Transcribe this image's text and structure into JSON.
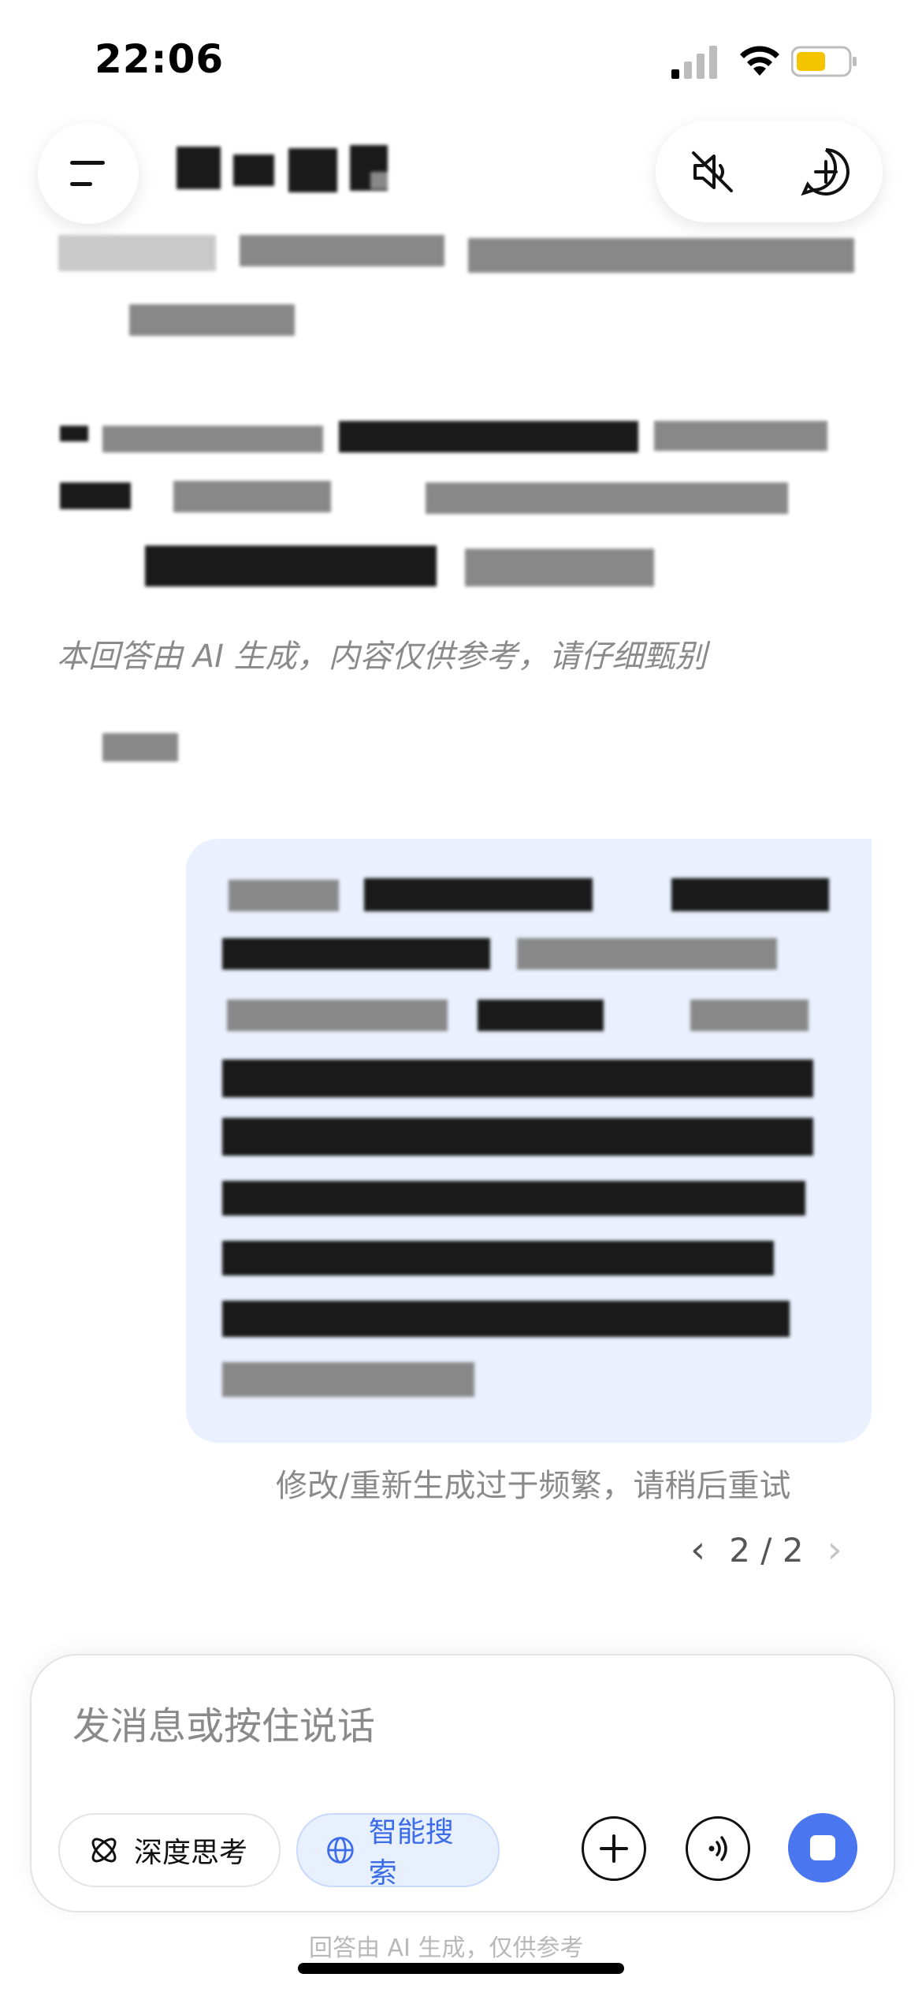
{
  "status_bar": {
    "time": "22:06"
  },
  "header": {
    "menu_icon": "menu-icon",
    "mute_icon": "speaker-off-icon",
    "new_chat_icon": "new-chat-icon"
  },
  "assistant": {
    "disclaimer": "本回答由 AI 生成，内容仅供参考，请仔细甄别"
  },
  "user_message": {
    "notice": "修改/重新生成过于频繁，请稍后重试",
    "pager": {
      "current": "2",
      "separator": "/",
      "total": "2"
    }
  },
  "composer": {
    "placeholder": "发消息或按住说话",
    "deep_think_label": "深度思考",
    "smart_search_label": "智能搜索",
    "add_icon": "plus-icon",
    "voice_icon": "voice-call-icon",
    "stop_icon": "stop-icon"
  },
  "footer_note": "回答由 AI 生成，仅供参考",
  "colors": {
    "accent": "#4a76f0",
    "bubble": "#eaf0fd",
    "search_chip": "#e8f0fe"
  }
}
